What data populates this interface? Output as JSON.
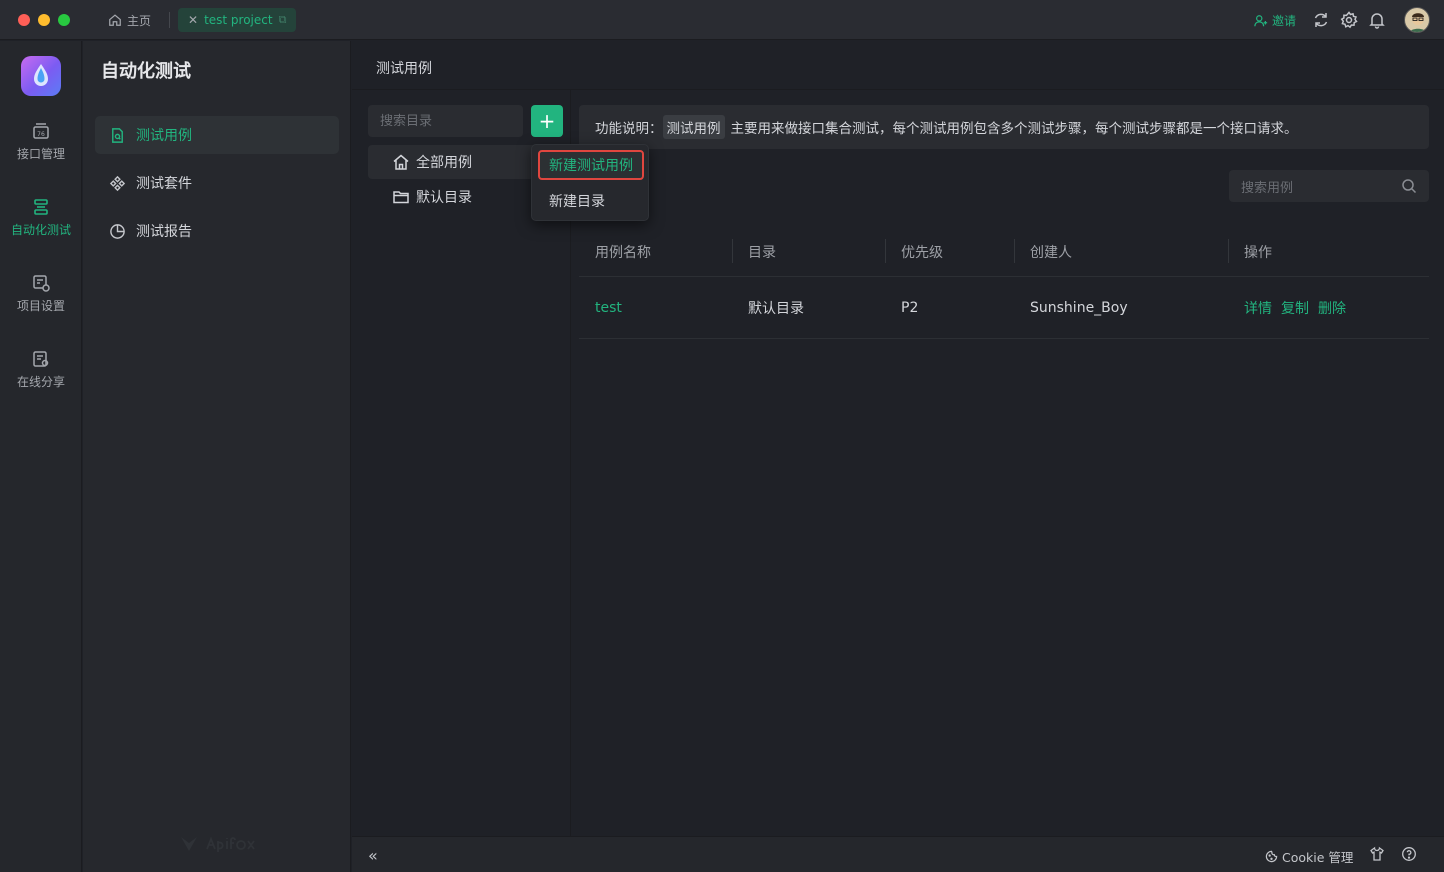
{
  "titlebar": {
    "home_tab": "主页",
    "project_tab": "test project",
    "invite": "邀请"
  },
  "rail": {
    "items": [
      {
        "label": "接口管理",
        "icon": "api-box-icon"
      },
      {
        "label": "自动化测试",
        "icon": "automation-stack-icon",
        "active": true
      },
      {
        "label": "项目设置",
        "icon": "project-settings-icon"
      },
      {
        "label": "在线分享",
        "icon": "share-doc-icon"
      }
    ]
  },
  "nav": {
    "title": "自动化测试",
    "items": [
      {
        "label": "测试用例",
        "icon": "file-search-icon",
        "active": true
      },
      {
        "label": "测试套件",
        "icon": "suite-diamond-icon"
      },
      {
        "label": "测试报告",
        "icon": "pie-report-icon"
      }
    ]
  },
  "main": {
    "page_title": "测试用例",
    "dir_search_placeholder": "搜索目录",
    "add_label": "+",
    "tree": [
      {
        "label": "全部用例",
        "icon": "home-icon",
        "active": true
      },
      {
        "label": "默认目录",
        "icon": "folder-icon"
      }
    ],
    "info": {
      "prefix": "功能说明：",
      "chip": "测试用例",
      "text": "主要用来做接口集合测试，每个测试用例包含多个测试步骤，每个测试步骤都是一个接口请求。"
    },
    "case_search_placeholder": "搜索用例",
    "table": {
      "headers": [
        "用例名称",
        "目录",
        "优先级",
        "创建人",
        "操作"
      ],
      "rows": [
        {
          "name": "test",
          "dir": "默认目录",
          "priority": "P2",
          "creator": "Sunshine_Boy",
          "actions": [
            "详情",
            "复制",
            "删除"
          ]
        }
      ]
    },
    "dropdown": {
      "items": [
        "新建测试用例",
        "新建目录"
      ]
    }
  },
  "footer": {
    "collapse": "«",
    "cookie": "Cookie 管理"
  },
  "colors": {
    "accent": "#22b47f",
    "highlight_border": "#e0463f"
  }
}
